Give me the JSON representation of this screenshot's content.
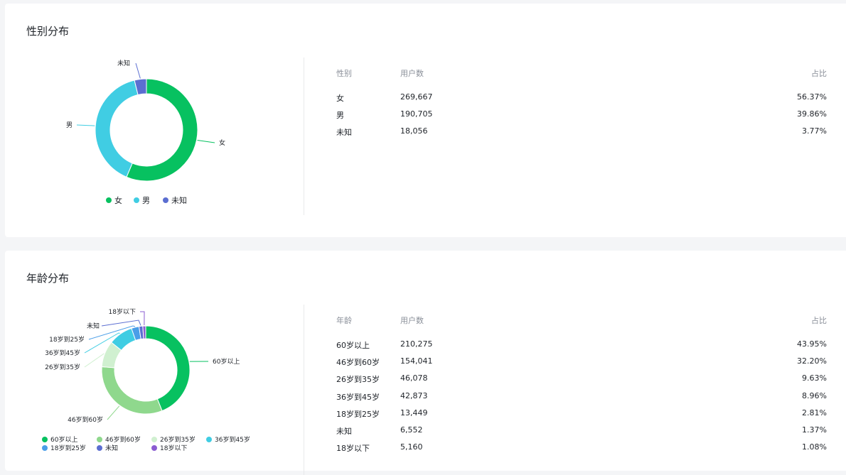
{
  "gender_section": {
    "title": "性别分布",
    "table": {
      "headers": [
        "性别",
        "用户数",
        "占比"
      ],
      "rows": [
        [
          "女",
          "269,667",
          "56.37%"
        ],
        [
          "男",
          "190,705",
          "39.86%"
        ],
        [
          "未知",
          "18,056",
          "3.77%"
        ]
      ]
    }
  },
  "age_section": {
    "title": "年龄分布",
    "table": {
      "headers": [
        "年龄",
        "用户数",
        "占比"
      ],
      "rows": [
        [
          "60岁以上",
          "210,275",
          "43.95%"
        ],
        [
          "46岁到60岁",
          "154,041",
          "32.20%"
        ],
        [
          "26岁到35岁",
          "46,078",
          "9.63%"
        ],
        [
          "36岁到45岁",
          "42,873",
          "8.96%"
        ],
        [
          "18岁到25岁",
          "13,449",
          "2.81%"
        ],
        [
          "未知",
          "6,552",
          "1.37%"
        ],
        [
          "18岁以下",
          "5,160",
          "1.08%"
        ]
      ]
    }
  },
  "chart_data": [
    {
      "type": "pie",
      "variant": "donut",
      "categories": [
        "女",
        "男",
        "未知"
      ],
      "values": [
        269667,
        190705,
        18056
      ],
      "colors": [
        "#07c160",
        "#40cde3",
        "#5b6ed1"
      ],
      "legend": "bottom"
    },
    {
      "type": "pie",
      "variant": "donut",
      "categories": [
        "60岁以上",
        "46岁到60岁",
        "26岁到35岁",
        "36岁到45岁",
        "18岁到25岁",
        "未知",
        "18岁以下"
      ],
      "values": [
        210275,
        154041,
        46078,
        42873,
        13449,
        6552,
        5160
      ],
      "colors": [
        "#07c160",
        "#8fd88d",
        "#d0f0d0",
        "#40cde3",
        "#4a9ee8",
        "#5b6ed1",
        "#8a5cd1"
      ],
      "legend": "bottom"
    }
  ]
}
